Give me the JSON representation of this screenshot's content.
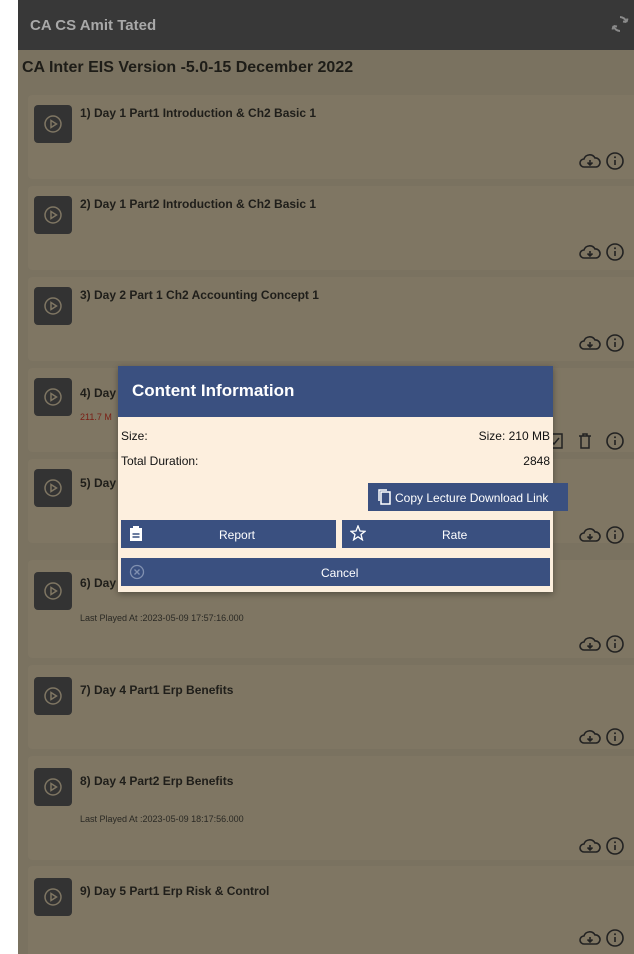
{
  "app": {
    "title": "CA CS Amit Tated"
  },
  "course": {
    "title": "CA Inter EIS Version -5.0-15 December 2022"
  },
  "lectures": [
    {
      "title": "1) Day 1 Part1 Introduction & Ch2 Basic 1"
    },
    {
      "title": "2) Day 1 Part2 Introduction & Ch2 Basic 1"
    },
    {
      "title": "3) Day 2 Part 1 Ch2 Accounting Concept 1"
    },
    {
      "title": "4) Day",
      "size": "211.7 M"
    },
    {
      "title": "5) Day"
    },
    {
      "title": "6) Day",
      "last_played": "Last Played At :2023-05-09 17:57:16.000"
    },
    {
      "title": "7) Day 4 Part1 Erp Benefits"
    },
    {
      "title": "8) Day 4 Part2  Erp Benefits",
      "last_played": "Last Played At :2023-05-09 18:17:56.000"
    },
    {
      "title": "9) Day 5 Part1 Erp Risk & Control"
    }
  ],
  "dialog": {
    "title": "Content Information",
    "size_label": "Size:",
    "size_value": "Size: 210 MB",
    "duration_label": "Total Duration:",
    "duration_value": "2848",
    "copy_label": "Copy Lecture Download Link",
    "report_label": "Report",
    "rate_label": "Rate",
    "cancel_label": "Cancel"
  },
  "icons": {
    "sync": "sync-icon",
    "play": "play-icon",
    "download": "cloud-download-icon",
    "info": "info-icon",
    "copy": "copy-icon",
    "report": "clipboard-icon",
    "rate": "star-icon",
    "cancel": "cancel-circle-icon",
    "check": "checkbox-icon",
    "delete": "trash-icon"
  },
  "colors": {
    "topbar": "#383838",
    "dialog_header": "#3a5080",
    "dialog_bg": "#fdefde",
    "overlay_bg": "#7a7260"
  }
}
